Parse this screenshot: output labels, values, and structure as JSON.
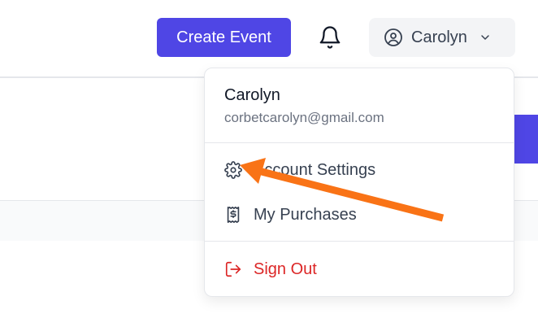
{
  "header": {
    "create_event_label": "Create Event",
    "user_name": "Carolyn"
  },
  "dropdown": {
    "name": "Carolyn",
    "email": "corbetcarolyn@gmail.com",
    "items": [
      {
        "label": "Account Settings",
        "icon": "gear-icon"
      },
      {
        "label": "My Purchases",
        "icon": "receipt-dollar-icon"
      },
      {
        "label": "Sign Out",
        "icon": "sign-out-icon"
      }
    ]
  },
  "colors": {
    "accent": "#4f46e5",
    "danger": "#dc2626",
    "annotation_arrow": "#f97316"
  }
}
